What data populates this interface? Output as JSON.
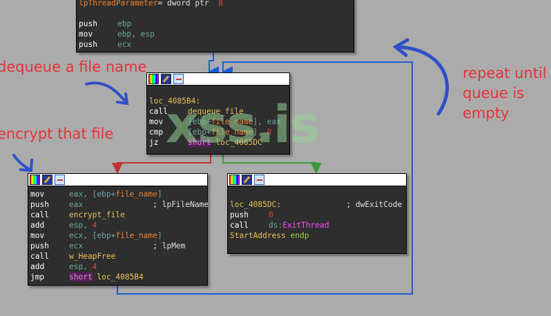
{
  "blocks": {
    "top": {
      "lines": [
        [
          [
            "lpThreadParameter",
            "o"
          ],
          [
            "= dword ptr  ",
            "c"
          ],
          [
            "8",
            "n"
          ]
        ],
        [],
        [
          [
            "push",
            "op"
          ],
          [
            "ebp",
            "r"
          ]
        ],
        [
          [
            "mov",
            "op"
          ],
          [
            "ebp, esp",
            "r"
          ]
        ],
        [
          [
            "push",
            "op"
          ],
          [
            "ecx",
            "r"
          ]
        ]
      ]
    },
    "middle": {
      "lines": [
        [],
        [],
        [
          [
            "loc_4085B4:",
            "y"
          ]
        ],
        [
          [
            "call",
            "op"
          ],
          [
            "dequeue_file",
            "y"
          ]
        ],
        [
          [
            "mov",
            "op"
          ],
          [
            "[ebp+",
            "r"
          ],
          [
            "file_name",
            "o"
          ],
          [
            "], eax",
            "r"
          ]
        ],
        [
          [
            "cmp",
            "op"
          ],
          [
            "[ebp+",
            "r"
          ],
          [
            "file_name",
            "o"
          ],
          [
            "], ",
            "r"
          ],
          [
            "0",
            "n"
          ]
        ],
        [
          [
            "jz",
            "op"
          ],
          [
            "short",
            "p"
          ],
          [
            " loc_4085DC",
            "y"
          ]
        ]
      ]
    },
    "left": {
      "lines": [
        [
          [
            "mov",
            "op"
          ],
          [
            "eax, [ebp+",
            "r"
          ],
          [
            "file_name",
            "o"
          ],
          [
            "]",
            "r"
          ]
        ],
        [
          [
            "push",
            "op"
          ],
          [
            "eax               ",
            "r"
          ],
          [
            "; lpFileName",
            "c"
          ]
        ],
        [
          [
            "call",
            "op"
          ],
          [
            "encrypt_file",
            "y"
          ]
        ],
        [
          [
            "add",
            "op"
          ],
          [
            "esp, ",
            "r"
          ],
          [
            "4",
            "n"
          ]
        ],
        [
          [
            "mov",
            "op"
          ],
          [
            "ecx, [ebp+",
            "r"
          ],
          [
            "file_name",
            "o"
          ],
          [
            "]",
            "r"
          ]
        ],
        [
          [
            "push",
            "op"
          ],
          [
            "ecx               ",
            "r"
          ],
          [
            "; lpMem",
            "c"
          ]
        ],
        [
          [
            "call",
            "op"
          ],
          [
            "w_HeapFree",
            "y"
          ]
        ],
        [
          [
            "add",
            "op"
          ],
          [
            "esp, ",
            "r"
          ],
          [
            "4",
            "n"
          ]
        ],
        [
          [
            "jmp",
            "op"
          ],
          [
            "short",
            "p"
          ],
          [
            " loc_4085B4",
            "y"
          ]
        ]
      ]
    },
    "right": {
      "lines": [
        [],
        [
          [
            "loc_4085DC:",
            "y"
          ],
          [
            "              ; dwExitCode",
            "c"
          ]
        ],
        [
          [
            "push",
            "op"
          ],
          [
            "0",
            "n"
          ]
        ],
        [
          [
            "call",
            "op"
          ],
          [
            "ds:",
            "r"
          ],
          [
            "ExitThread",
            "m"
          ]
        ],
        [
          [
            "StartAddress ",
            "y"
          ],
          [
            "endp",
            "g"
          ]
        ]
      ]
    }
  },
  "annotations": {
    "dequeue": "dequeue a file name",
    "encrypt": "encrypt that file",
    "repeat1": "repeat until",
    "repeat2": "queue is",
    "repeat3": "empty"
  },
  "watermark": "xss.is",
  "colors": {
    "background": "#ababab",
    "block": "#2e2e2e",
    "edge_normal": "#1a5fd0",
    "edge_true": "#3a9a3a",
    "edge_false": "#c03030",
    "annotation": "#e8303a"
  }
}
